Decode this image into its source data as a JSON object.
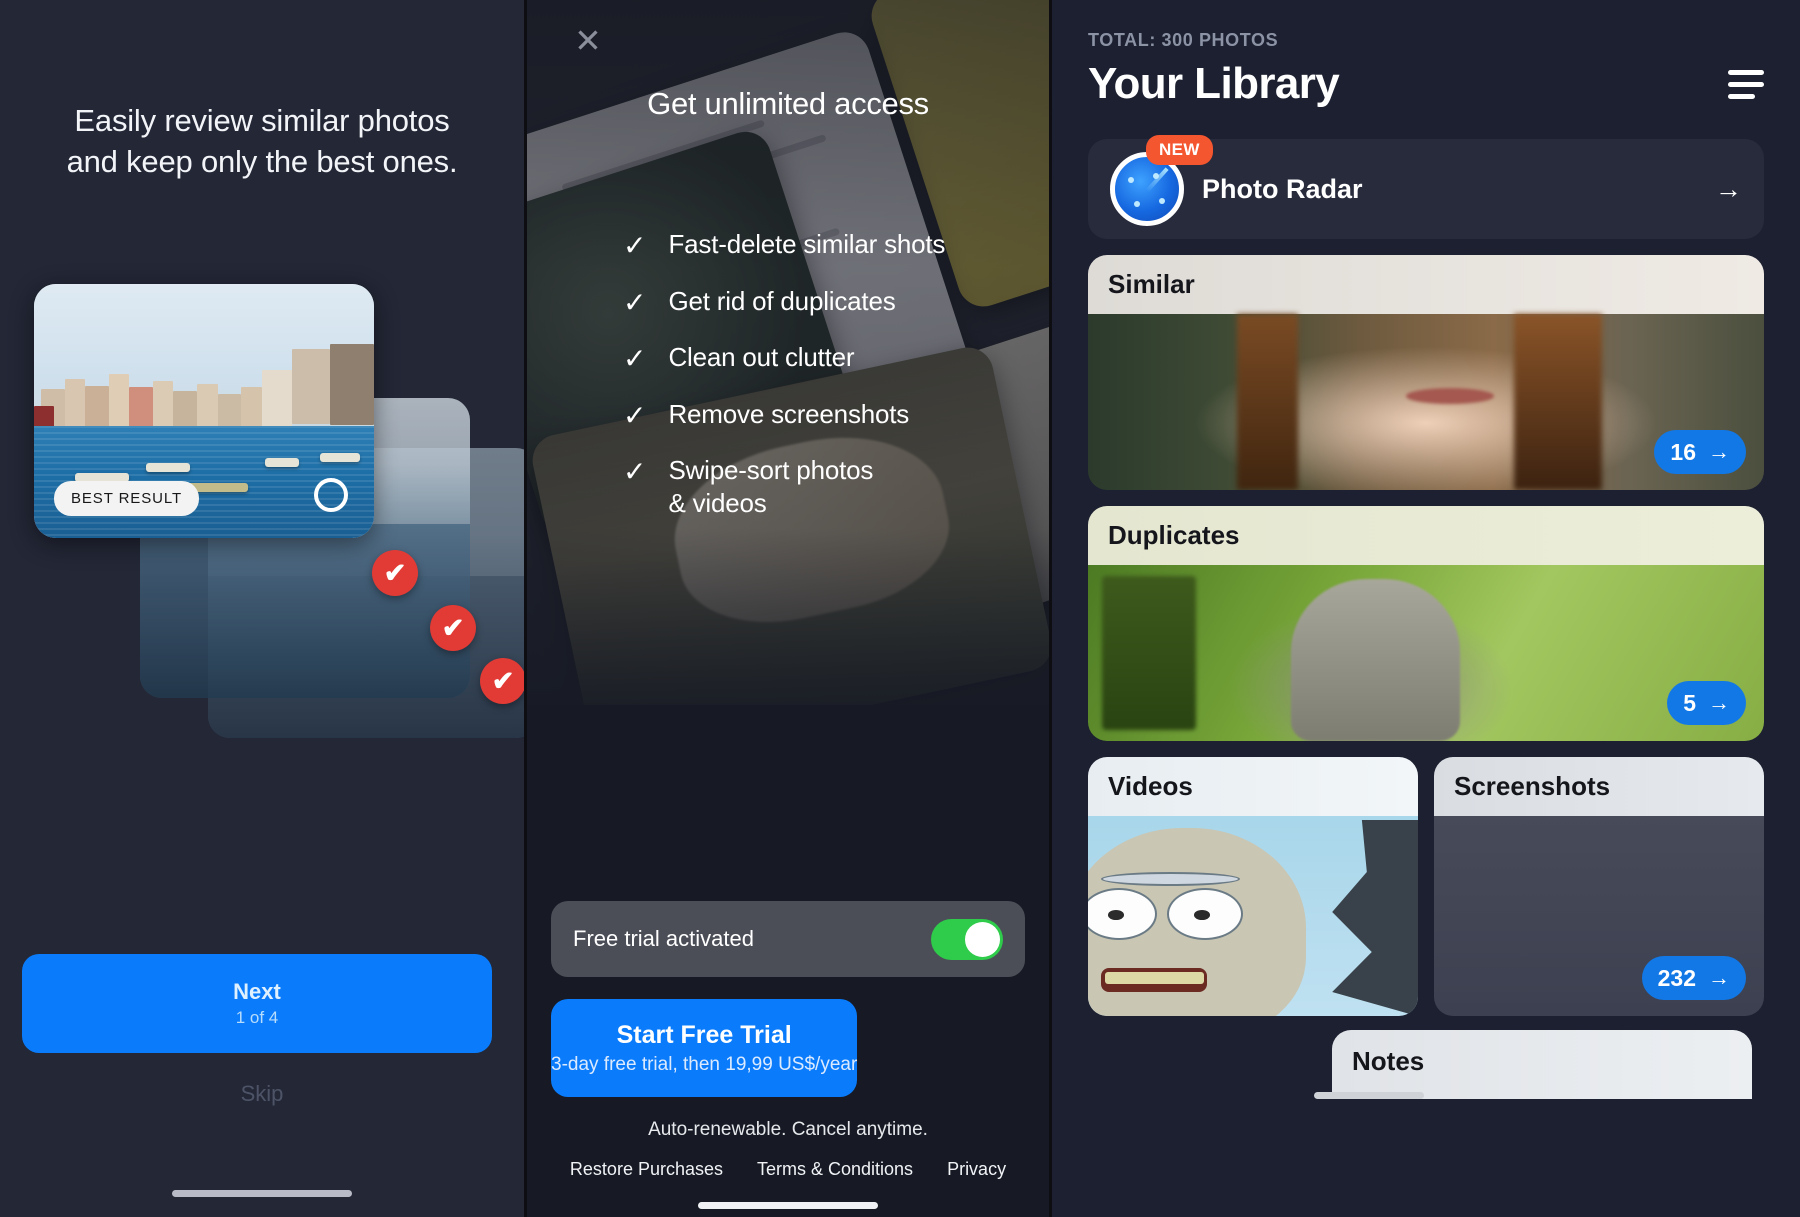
{
  "onboarding": {
    "headline": "Easily review similar photos\nand keep only the best ones.",
    "best_result_badge": "BEST RESULT",
    "next_label": "Next",
    "next_sub": "1 of 4",
    "skip_label": "Skip",
    "select_ring_icon": "circle-outline-icon",
    "checkmark_icon": "check-circle-icon",
    "check_glyph": "✔"
  },
  "paywall": {
    "close_icon": "close-icon",
    "close_glyph": "✕",
    "title": "Get unlimited access",
    "check_glyph": "✓",
    "features": [
      "Fast-delete similar shots",
      "Get rid of duplicates",
      "Clean out clutter",
      "Remove screenshots",
      "Swipe-sort photos\n& videos"
    ],
    "trial_toggle_label": "Free trial activated",
    "trial_toggle_on": true,
    "toggle_color": "#2ecc4a",
    "cta_title": "Start Free Trial",
    "cta_subtitle": "3-day free trial, then 19,99 US$/year",
    "cta_color": "#0a7cfb",
    "auto_note": "Auto-renewable. Cancel anytime.",
    "links": [
      "Restore Purchases",
      "Terms & Conditions",
      "Privacy"
    ]
  },
  "library": {
    "total_label": "TOTAL: 300 PHOTOS",
    "title": "Your Library",
    "menu_icon": "hamburger-menu-icon",
    "radar": {
      "icon": "radar-icon",
      "badge": "NEW",
      "badge_color": "#f4562f",
      "label": "Photo Radar",
      "arrow_icon": "arrow-right-icon",
      "arrow_glyph": "→"
    },
    "arrow_glyph": "→",
    "categories": [
      {
        "name": "Similar",
        "count": "16"
      },
      {
        "name": "Duplicates",
        "count": "5"
      },
      {
        "name": "Videos",
        "count": ""
      },
      {
        "name": "Screenshots",
        "count": "232"
      },
      {
        "name": "Notes",
        "count": ""
      }
    ],
    "pill_color": "#1278e6"
  }
}
